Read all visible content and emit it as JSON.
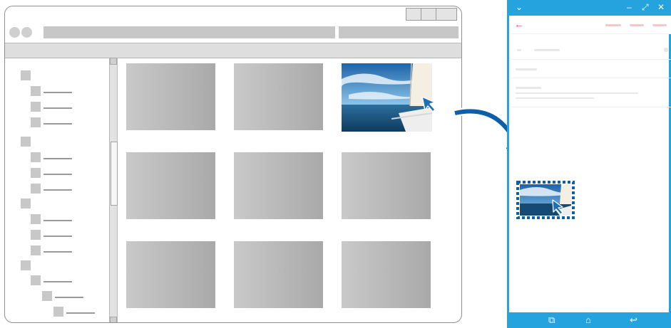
{
  "colors": {
    "phone_accent": "#25a3de",
    "cursor": "#1f6fb5",
    "drag_arrow": "#0d5fa8",
    "placeholder_gray": "#b3b3b3"
  },
  "icons": {
    "cursor": "mouse-pointer-icon",
    "drag_arrow": "curved-arrow-icon",
    "phone_back": "back-arrow-icon",
    "phone_recents": "recent-apps-icon",
    "phone_home": "home-icon",
    "phone_return": "back-icon"
  },
  "phone": {
    "top_glyphs": {
      "collapse": "⌄",
      "minimize": "–",
      "expand": "⤢",
      "close": "✕"
    },
    "back_glyph": "←",
    "nav_glyphs": {
      "recents": "⧉",
      "home": "⌂",
      "back": "↩"
    }
  }
}
